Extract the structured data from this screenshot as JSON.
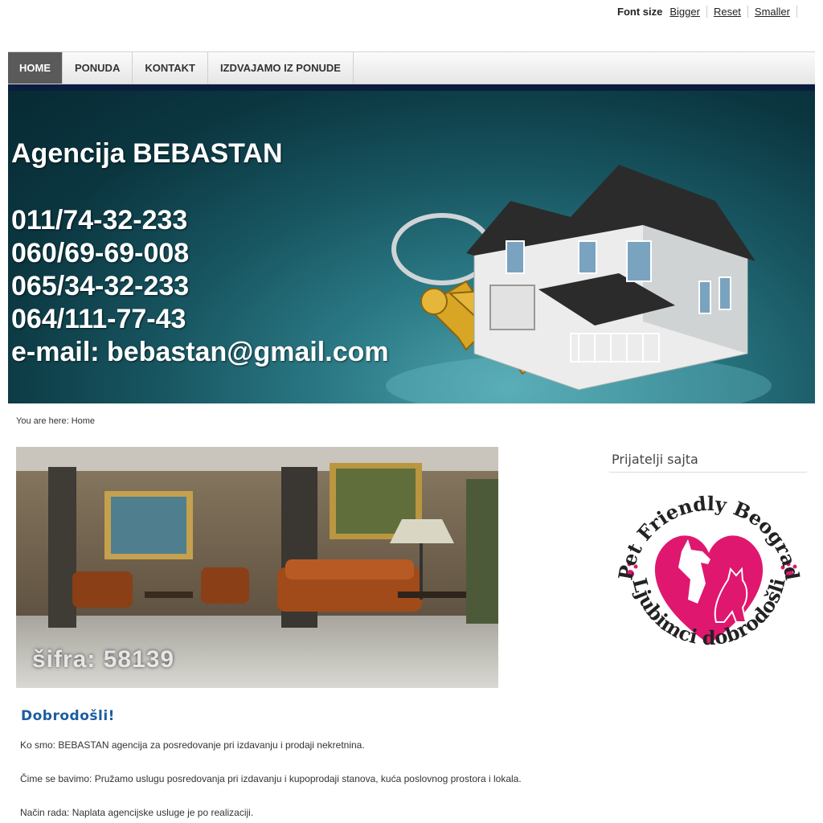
{
  "fontsize": {
    "label": "Font size",
    "bigger": "Bigger",
    "reset": "Reset",
    "smaller": "Smaller"
  },
  "nav": {
    "items": [
      {
        "label": "HOME",
        "active": true
      },
      {
        "label": "PONUDA",
        "active": false
      },
      {
        "label": "KONTAKT",
        "active": false
      },
      {
        "label": "IZDVAJAMO IZ PONUDE",
        "active": false
      }
    ]
  },
  "banner": {
    "title": "Agencija BEBASTAN",
    "phones": [
      "011/74-32-233",
      "060/69-69-008",
      "065/34-32-233",
      "064/111-77-43"
    ],
    "email": "e-mail: bebastan@gmail.com"
  },
  "breadcrumb": {
    "text": "You are here: Home"
  },
  "photo": {
    "code": "šifra: 58139"
  },
  "content": {
    "heading": "Dobrodošli!",
    "p1": "Ko smo: BEBASTAN agencija za posredovanje pri izdavanju i prodaji nekretnina.",
    "p2": "Čime se bavimo: Pružamo uslugu posredovanja pri izdavanju i kupoprodaji stanova, kuća poslovnog prostora i lokala.",
    "p3": "Način rada: Naplata agencijske usluge je po realizaciji."
  },
  "sidebar": {
    "title": "Prijatelji sajta",
    "logo_top_text": "Pet Friendly Beograd",
    "logo_bottom_text": "Ljubimci dobrodošli"
  },
  "colors": {
    "accent": "#1b5da0",
    "nav_active": "#5a5a5a",
    "pet_pink": "#e0176f"
  }
}
